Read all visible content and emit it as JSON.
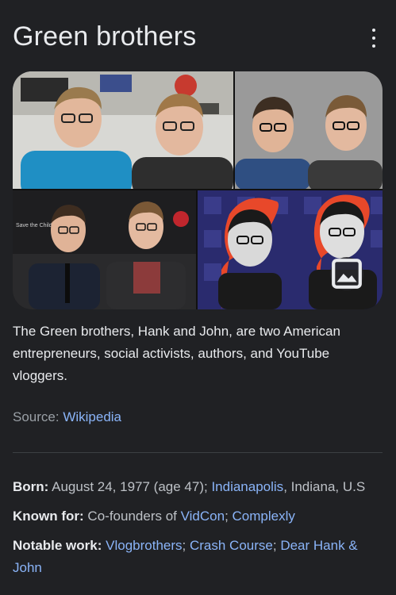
{
  "header": {
    "title": "Green brothers",
    "more_icon": "more-vert-icon"
  },
  "gallery": {
    "image_button_icon": "image-icon",
    "photo3_sign_text": "Save the Children"
  },
  "description": "The Green brothers, Hank and John, are two American entrepreneurs, social activists, authors, and YouTube vloggers.",
  "source": {
    "label": "Source: ",
    "link": "Wikipedia"
  },
  "facts": {
    "born": {
      "label": "Born:",
      "text": " August 24, 1977 (age 47); ",
      "link": "Indianapolis",
      "suffix": ", Indiana, U.S"
    },
    "known_for": {
      "label": "Known for:",
      "text": " Co-founders of ",
      "link1": "VidCon",
      "sep": "; ",
      "link2": "Complexly"
    },
    "notable_work": {
      "label": "Notable work:",
      "link1": "Vlogbrothers",
      "sep1": "; ",
      "link2": "Crash Course",
      "sep2": "; ",
      "link3": "Dear Hank & John"
    }
  },
  "colors": {
    "background": "#202124",
    "text": "#e8eaed",
    "link": "#8ab4f8",
    "muted": "#9aa0a6"
  }
}
